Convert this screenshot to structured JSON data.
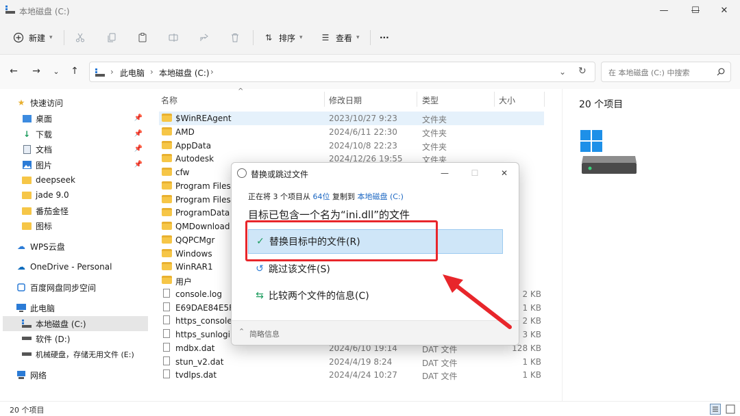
{
  "window": {
    "title": "本地磁盘 (C:)",
    "controls": {
      "minimize": "—",
      "maximize": "☐",
      "close": "✕"
    }
  },
  "toolbar": {
    "new_label": "新建",
    "sort_label": "排序",
    "view_label": "查看",
    "more_label": "···"
  },
  "nav": {
    "back": "←",
    "forward": "→",
    "recent": "⌄",
    "up": "↑"
  },
  "address": {
    "crumbs": [
      "此电脑",
      "本地磁盘 (C:)"
    ],
    "search_placeholder": "在 本地磁盘 (C:) 中搜索"
  },
  "sidebar": {
    "items": [
      {
        "label": "快速访问"
      },
      {
        "label": "桌面"
      },
      {
        "label": "下载"
      },
      {
        "label": "文档"
      },
      {
        "label": "图片"
      },
      {
        "label": "deepseek"
      },
      {
        "label": "jade 9.0"
      },
      {
        "label": "番茄金怪"
      },
      {
        "label": "图标"
      },
      {
        "label": "WPS云盘"
      },
      {
        "label": "OneDrive - Personal"
      },
      {
        "label": "百度网盘同步空间"
      },
      {
        "label": "此电脑"
      },
      {
        "label": "本地磁盘 (C:)"
      },
      {
        "label": "软件 (D:)"
      },
      {
        "label": "机械硬盘，存储无用文件 (E:)"
      },
      {
        "label": "网络"
      }
    ]
  },
  "columns": {
    "name": "名称",
    "date": "修改日期",
    "type": "类型",
    "size": "大小"
  },
  "files": [
    {
      "name": "$WinREAgent",
      "date": "2023/10/27 9:23",
      "type": "文件夹",
      "size": ""
    },
    {
      "name": "AMD",
      "date": "2024/6/11 22:30",
      "type": "文件夹",
      "size": ""
    },
    {
      "name": "AppData",
      "date": "2024/10/8 22:23",
      "type": "文件夹",
      "size": ""
    },
    {
      "name": "Autodesk",
      "date": "2024/12/26 19:55",
      "type": "文件夹",
      "size": ""
    },
    {
      "name": "cfw",
      "date": "",
      "type": "",
      "size": ""
    },
    {
      "name": "Program Files",
      "date": "",
      "type": "",
      "size": ""
    },
    {
      "name": "Program Files (",
      "date": "",
      "type": "",
      "size": ""
    },
    {
      "name": "ProgramData",
      "date": "",
      "type": "",
      "size": ""
    },
    {
      "name": "QMDownload",
      "date": "",
      "type": "",
      "size": ""
    },
    {
      "name": "QQPCMgr",
      "date": "",
      "type": "",
      "size": ""
    },
    {
      "name": "Windows",
      "date": "",
      "type": "",
      "size": ""
    },
    {
      "name": "WinRAR1",
      "date": "",
      "type": "",
      "size": ""
    },
    {
      "name": "用户",
      "date": "",
      "type": "",
      "size": ""
    },
    {
      "name": "console.log",
      "date": "",
      "type": "",
      "size": "2 KB"
    },
    {
      "name": "E69DAE84E5FE",
      "date": "",
      "type": "",
      "size": "1 KB"
    },
    {
      "name": "https_console.s",
      "date": "",
      "type": "",
      "size": "2 KB"
    },
    {
      "name": "https_sunlogin.",
      "date": "",
      "type": "",
      "size": "3 KB"
    },
    {
      "name": "mdbx.dat",
      "date": "2024/6/10 19:14",
      "type": "DAT 文件",
      "size": "128 KB"
    },
    {
      "name": "stun_v2.dat",
      "date": "2024/4/19 8:24",
      "type": "DAT 文件",
      "size": "1 KB"
    },
    {
      "name": "tvdlps.dat",
      "date": "2024/4/24 10:27",
      "type": "DAT 文件",
      "size": "1 KB"
    }
  ],
  "details": {
    "count": "20 个项目"
  },
  "status": {
    "count": "20 个项目"
  },
  "dialog": {
    "title": "替换或跳过文件",
    "progress_prefix": "正在将 3 个项目从",
    "source": "64位",
    "progress_mid": "复制到",
    "destination": "本地磁盘 (C:)",
    "conflict": "目标已包含一个名为“ini.dll”的文件",
    "options": [
      {
        "label": "替换目标中的文件(R)",
        "icon": "check-icon"
      },
      {
        "label": "跳过该文件(S)",
        "icon": "skip-icon"
      },
      {
        "label": "比较两个文件的信息(C)",
        "icon": "compare-icon"
      }
    ],
    "footer": "简略信息"
  },
  "colors": {
    "accent": "#1a66c2",
    "highlight": "#cfe6f8",
    "annotation_red": "#e8262b",
    "folder": "#f6c647"
  }
}
